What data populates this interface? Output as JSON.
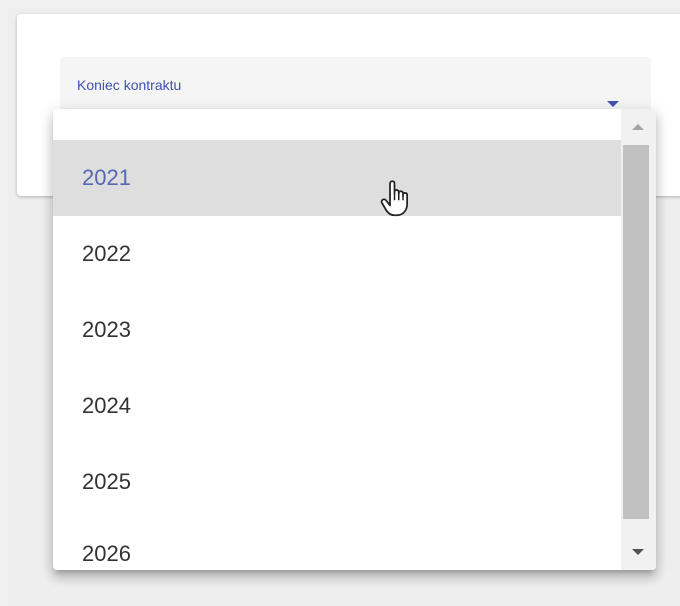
{
  "field": {
    "label": "Koniec kontraktu"
  },
  "options": [
    {
      "label": "2021",
      "selected": true
    },
    {
      "label": "2022",
      "selected": false
    },
    {
      "label": "2023",
      "selected": false
    },
    {
      "label": "2024",
      "selected": false
    },
    {
      "label": "2025",
      "selected": false
    },
    {
      "label": "2026",
      "selected": false
    }
  ],
  "icons": {
    "field_caret": "caret-down-icon",
    "scroll_up": "chevron-up-icon",
    "scroll_down": "chevron-down-icon",
    "cursor": "hand-pointer-icon"
  },
  "colors": {
    "accent": "#3f51b5",
    "selected_text": "#5866b4",
    "selected_bg": "#dedede"
  }
}
